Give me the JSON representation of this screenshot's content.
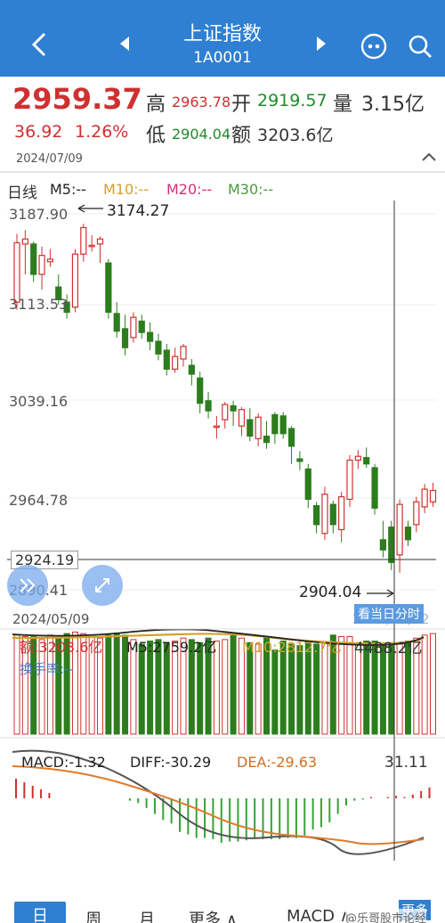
{
  "header": {
    "title": "上证指数",
    "code": "1A0001",
    "back_icon": "chevron-left-icon",
    "prev_icon": "triangle-left-icon",
    "next_icon": "triangle-right-icon",
    "menu_icon": "more-dots-icon",
    "search_icon": "search-icon"
  },
  "quote": {
    "price": "2959.37",
    "change": "36.92",
    "change_pct": "1.26%",
    "date": "2024/07/09",
    "high_label": "高",
    "high": "2963.78",
    "low_label": "低",
    "low": "2904.04",
    "open_label": "开",
    "open": "2919.57",
    "amount_label": "额",
    "amount": "3203.6亿",
    "volume_label": "量",
    "volume": "3.15亿"
  },
  "ma_legend": {
    "period": "日线",
    "m5": "M5:--",
    "m10": "M10:--",
    "m20": "M20:--",
    "m30": "M30:--"
  },
  "price_axis": [
    "3187.90",
    "3113.53",
    "3039.16",
    "2964.78",
    "2890.41"
  ],
  "annotations": {
    "high_mark": "3174.27",
    "low_mark": "2904.04",
    "crosshair_price": "2924.19",
    "start_date": "2024/05/09",
    "end_date": "2024/07/12",
    "intraday_button": "看当日分时"
  },
  "volume_panel": {
    "amount": "额:3203.6亿",
    "m5": "M5:2759.2亿",
    "m10": "M10:2812.7亿",
    "max": "4488.2亿",
    "turnover": "换手率:--"
  },
  "macd_panel": {
    "macd": "MACD:-1.32",
    "diff": "DIFF:-30.29",
    "dea": "DEA:-29.63",
    "max": "31.11"
  },
  "bottom_tabs": {
    "day": "日",
    "week": "周",
    "month": "月",
    "more": "更多 ∧",
    "indicator": "MACD ∧",
    "watermark": "@乐哥股市论经",
    "more_button": "更多"
  },
  "colors": {
    "header_bg": "#2f7fd2",
    "up": "#d03030",
    "down": "#2d7d1e",
    "ma5": "#222222",
    "ma10": "#d4a12a",
    "ma20": "#d0307a",
    "ma30": "#4a9a3a"
  },
  "chart_data": {
    "type": "candlestick",
    "x_range": [
      "2024/05/09",
      "2024/07/12"
    ],
    "ylim": [
      2890.41,
      3187.9
    ],
    "candles": [
      {
        "o": 3118,
        "c": 3165,
        "h": 3172,
        "l": 3112
      },
      {
        "o": 3164,
        "c": 3168,
        "h": 3175,
        "l": 3140
      },
      {
        "o": 3164,
        "c": 3140,
        "h": 3166,
        "l": 3134
      },
      {
        "o": 3140,
        "c": 3155,
        "h": 3162,
        "l": 3128
      },
      {
        "o": 3150,
        "c": 3152,
        "h": 3160,
        "l": 3146
      },
      {
        "o": 3130,
        "c": 3120,
        "h": 3140,
        "l": 3116
      },
      {
        "o": 3118,
        "c": 3110,
        "h": 3124,
        "l": 3105
      },
      {
        "o": 3114,
        "c": 3156,
        "h": 3160,
        "l": 3110
      },
      {
        "o": 3156,
        "c": 3177,
        "h": 3180,
        "l": 3150
      },
      {
        "o": 3163,
        "c": 3163,
        "h": 3171,
        "l": 3158
      },
      {
        "o": 3164,
        "c": 3168,
        "h": 3170,
        "l": 3149
      },
      {
        "o": 3149,
        "c": 3110,
        "h": 3152,
        "l": 3105
      },
      {
        "o": 3109,
        "c": 3095,
        "h": 3118,
        "l": 3090
      },
      {
        "o": 3097,
        "c": 3082,
        "h": 3108,
        "l": 3076
      },
      {
        "o": 3090,
        "c": 3106,
        "h": 3110,
        "l": 3086
      },
      {
        "o": 3103,
        "c": 3094,
        "h": 3108,
        "l": 3089
      },
      {
        "o": 3094,
        "c": 3087,
        "h": 3102,
        "l": 3080
      },
      {
        "o": 3087,
        "c": 3077,
        "h": 3093,
        "l": 3072
      },
      {
        "o": 3080,
        "c": 3065,
        "h": 3085,
        "l": 3060
      },
      {
        "o": 3065,
        "c": 3075,
        "h": 3082,
        "l": 3062
      },
      {
        "o": 3073,
        "c": 3083,
        "h": 3085,
        "l": 3067
      },
      {
        "o": 3068,
        "c": 3061,
        "h": 3073,
        "l": 3052
      },
      {
        "o": 3058,
        "c": 3038,
        "h": 3063,
        "l": 3030
      },
      {
        "o": 3040,
        "c": 3032,
        "h": 3047,
        "l": 3026
      },
      {
        "o": 3020,
        "c": 3020,
        "h": 3028,
        "l": 3010
      },
      {
        "o": 3025,
        "c": 3037,
        "h": 3039,
        "l": 3018
      },
      {
        "o": 3036,
        "c": 3032,
        "h": 3040,
        "l": 3020
      },
      {
        "o": 3020,
        "c": 3033,
        "h": 3035,
        "l": 3012
      },
      {
        "o": 3025,
        "c": 3012,
        "h": 3034,
        "l": 3008
      },
      {
        "o": 3010,
        "c": 3027,
        "h": 3030,
        "l": 3004
      },
      {
        "o": 3012,
        "c": 3007,
        "h": 3024,
        "l": 3002
      },
      {
        "o": 3029,
        "c": 3014,
        "h": 3031,
        "l": 3006
      },
      {
        "o": 3028,
        "c": 3014,
        "h": 3031,
        "l": 3010
      },
      {
        "o": 3018,
        "c": 3004,
        "h": 3020,
        "l": 2990
      },
      {
        "o": 2994,
        "c": 2992,
        "h": 3000,
        "l": 2985
      },
      {
        "o": 2986,
        "c": 2962,
        "h": 2990,
        "l": 2955
      },
      {
        "o": 2957,
        "c": 2942,
        "h": 2960,
        "l": 2935
      },
      {
        "o": 2935,
        "c": 2966,
        "h": 2972,
        "l": 2930
      },
      {
        "o": 2958,
        "c": 2942,
        "h": 2961,
        "l": 2935
      },
      {
        "o": 2938,
        "c": 2964,
        "h": 2968,
        "l": 2928
      },
      {
        "o": 2962,
        "c": 2993,
        "h": 2997,
        "l": 2956
      },
      {
        "o": 2993,
        "c": 2996,
        "h": 3001,
        "l": 2986
      },
      {
        "o": 2995,
        "c": 2990,
        "h": 3003,
        "l": 2987
      },
      {
        "o": 2987,
        "c": 2955,
        "h": 2990,
        "l": 2950
      },
      {
        "o": 2930,
        "c": 2922,
        "h": 2945,
        "l": 2916
      },
      {
        "o": 2940,
        "c": 2912,
        "h": 2945,
        "l": 2906
      },
      {
        "o": 2918,
        "c": 2958,
        "h": 2962,
        "l": 2904
      },
      {
        "o": 2940,
        "c": 2930,
        "h": 2945,
        "l": 2925
      },
      {
        "o": 2942,
        "c": 2960,
        "h": 2964,
        "l": 2936
      },
      {
        "o": 2956,
        "c": 2970,
        "h": 2974,
        "l": 2951
      },
      {
        "o": 2960,
        "c": 2969,
        "h": 2975,
        "l": 2956
      }
    ],
    "volume": [
      3300,
      3250,
      3250,
      3150,
      3300,
      3200,
      3350,
      3400,
      3350,
      3300,
      3200,
      3300,
      3350,
      3300,
      3150,
      3000,
      3100,
      3150,
      3050,
      3100,
      3200,
      3150,
      3050,
      3200,
      3100,
      3150,
      3300,
      3200,
      3050,
      3000,
      3250,
      2800,
      3100,
      3000,
      2950,
      3100,
      3000,
      3050,
      3300,
      3250,
      3250,
      3000,
      3100,
      3100,
      2950,
      2950,
      3000,
      3100,
      3200,
      3300,
      3350
    ],
    "macd": [
      -2,
      -4,
      -8,
      -13,
      -18,
      -21,
      -28,
      -30,
      -33,
      -33,
      -34,
      -37,
      -36,
      -36,
      -35,
      -34,
      -34,
      -34,
      -34,
      -33,
      -33,
      -31,
      -26,
      -24,
      -20,
      -13,
      -6,
      -2,
      -1,
      1,
      0,
      1,
      2,
      1,
      3,
      6,
      9
    ]
  }
}
